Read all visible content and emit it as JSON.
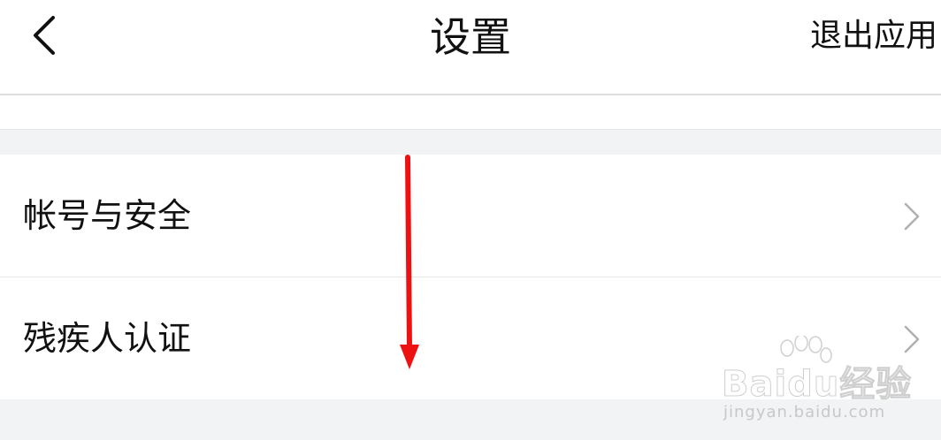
{
  "header": {
    "title": "设置",
    "exit_label": "退出应用",
    "back_icon": "chevron-left-icon"
  },
  "settings": {
    "items": [
      {
        "label": "帐号与安全",
        "icon": "chevron-right-icon"
      },
      {
        "label": "残疾人认证",
        "icon": "chevron-right-icon"
      }
    ]
  },
  "watermark": {
    "brand": "Baidu经验",
    "url": "jingyan.baidu.com"
  },
  "colors": {
    "background": "#f2f3f5",
    "surface": "#ffffff",
    "text": "#111111",
    "divider": "#e6e6e6",
    "chevron": "#b0b0b0",
    "annotation_arrow": "#ee1111"
  }
}
